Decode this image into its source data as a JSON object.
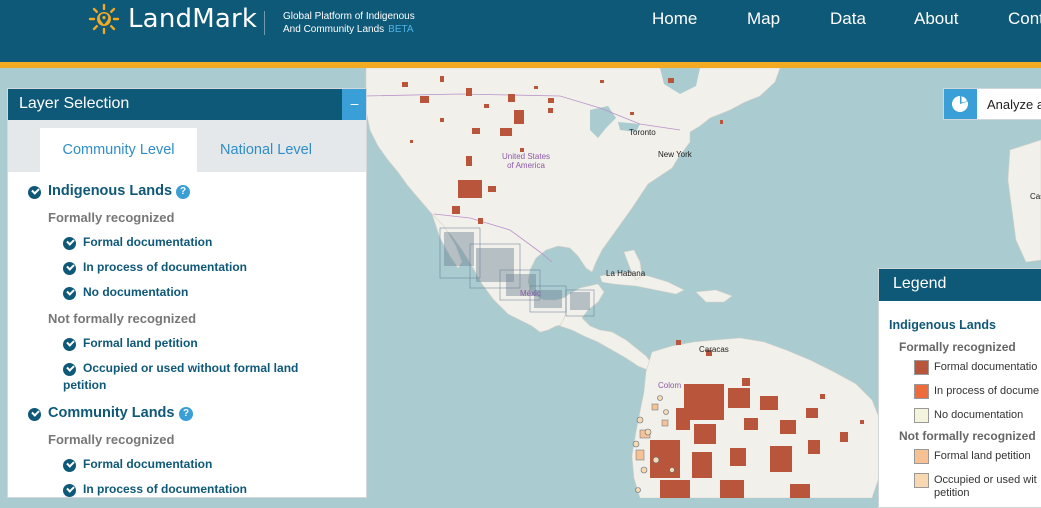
{
  "header": {
    "brand": "LandMark",
    "tagline_line1": "Global Platform of Indigenous",
    "tagline_line2": "And Community Lands",
    "beta": "BETA",
    "nav": [
      "Home",
      "Map",
      "Data",
      "About",
      "Cont"
    ]
  },
  "map": {
    "labels": {
      "toronto": "Toronto",
      "new_york": "New York",
      "usa_line1": "United States",
      "usa_line2": "of America",
      "la_habana": "La Habana",
      "caracas": "Caracas",
      "colombia": "Colom",
      "mexico": "Méxic",
      "cas": "Cas"
    }
  },
  "layer_panel": {
    "title": "Layer Selection",
    "collapse": "–",
    "tabs": [
      "Community Level",
      "National Level"
    ],
    "indigenous": {
      "label": "Indigenous Lands",
      "formal_header": "Formally recognized",
      "formal_items": [
        "Formal documentation",
        "In process of documentation",
        "No documentation"
      ],
      "informal_header": "Not formally recognized",
      "informal_items": [
        "Formal land petition",
        "Occupied or used without formal land petition"
      ]
    },
    "community": {
      "label": "Community Lands",
      "formal_header": "Formally recognized",
      "formal_items": [
        "Formal documentation",
        "In process of documentation"
      ]
    },
    "help": "?"
  },
  "analyze": {
    "label": "Analyze a"
  },
  "legend": {
    "title": "Legend",
    "category": "Indigenous Lands",
    "formal_header": "Formally recognized",
    "informal_header": "Not formally recognized",
    "items": [
      {
        "label": "Formal documentatio",
        "color": "#b8553a"
      },
      {
        "label": "In process of docume",
        "color": "#ee6b3b"
      },
      {
        "label": "No documentation",
        "color": "#f4f4dc"
      },
      {
        "label": "Formal land petition",
        "color": "#f7c193"
      },
      {
        "label": "Occupied or used wit petition",
        "color": "#f7d8b0"
      }
    ]
  },
  "colors": {
    "header": "#0e5878",
    "stripe": "#f1aa22",
    "accent": "#3a9fd7",
    "water": "#aacbd0",
    "land": "#f2f0ea",
    "indigenous": "#b8553a"
  }
}
